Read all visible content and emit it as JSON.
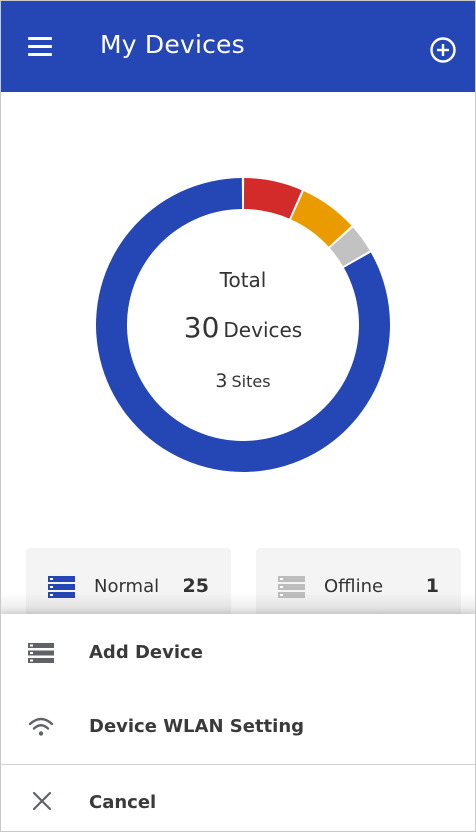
{
  "header": {
    "title": "My Devices",
    "menu_icon": "hamburger-menu-icon",
    "add_icon": "add-circle-icon",
    "color": "#2547b5"
  },
  "summary": {
    "total_label": "Total",
    "device_count": "30",
    "device_unit": "Devices",
    "site_count": "3",
    "site_unit": "Sites"
  },
  "chart_data": {
    "type": "pie",
    "variant": "donut",
    "slices": [
      {
        "value": 25,
        "color": "#2547b5"
      },
      {
        "value": 2,
        "color": "#d32a2a"
      },
      {
        "value": 2,
        "color": "#e99b00"
      },
      {
        "value": 1,
        "color": "#c2c2c2"
      }
    ]
  },
  "status_cards": [
    {
      "label": "Normal",
      "count": "25",
      "icon": "server-stack-icon",
      "icon_color": "#2547b5"
    },
    {
      "label": "Offline",
      "count": "1",
      "icon": "server-stack-icon",
      "icon_color": "#bdbdbd"
    }
  ],
  "action_sheet": {
    "items": [
      {
        "label": "Add Device",
        "icon": "server-stack-icon"
      },
      {
        "label": "Device WLAN Setting",
        "icon": "wifi-icon"
      }
    ],
    "cancel": {
      "label": "Cancel",
      "icon": "close-icon"
    }
  }
}
